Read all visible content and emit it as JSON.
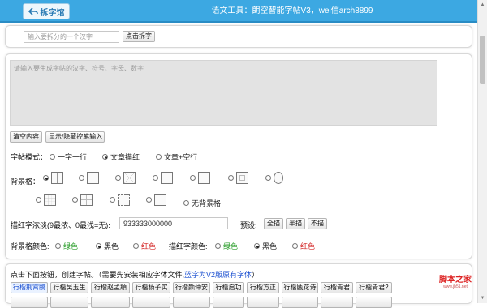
{
  "app": {
    "tab_label": "拆字馆",
    "title": "语文工具：朗空智能字帖V3，wei信arch8899"
  },
  "split": {
    "placeholder": "输入要拆分的一个汉字",
    "button": "点击拆字"
  },
  "editor": {
    "placeholder": "请输入要生成字帖的汉字、符号、字母、数字",
    "clear_button": "清空内容",
    "toggle_button": "显示/隐藏控笔输入"
  },
  "mode": {
    "label": "字帖模式：",
    "options": [
      "一字一行",
      "文章描红",
      "文章+空行"
    ],
    "selected": "文章描红"
  },
  "background": {
    "label": "背景格：",
    "none_label": "无背景格"
  },
  "shade": {
    "label": "描红字浓淡(9最浓、0最浅=无):",
    "value": "933333000000",
    "preset_label": "预设:",
    "presets": [
      "全描",
      "半描",
      "不描"
    ]
  },
  "colors": {
    "bg_label": "背景格颜色:",
    "trace_label": "描红字颜色:",
    "green": "绿色",
    "black": "黑色",
    "red": "红色",
    "green_hex": "#2a9d2a",
    "red_hex": "#d42a2a"
  },
  "create": {
    "hint": "点击下面按钮，创建字帖。（需要先安装相应字体文件,",
    "link": "蓝字为V2版原有字体",
    "hint_end": "）",
    "fonts": [
      "行楷荆霄鹏",
      "行楷吴玉生",
      "行楷赵孟頫",
      "行楷杨子实",
      "行楷颜仲安",
      "行楷启功",
      "行楷方正",
      "行楷瓯花诗",
      "行楷青君",
      "行楷青君2"
    ]
  },
  "watermark": {
    "main": "脚本之家",
    "sub": "www.jb51.net"
  }
}
